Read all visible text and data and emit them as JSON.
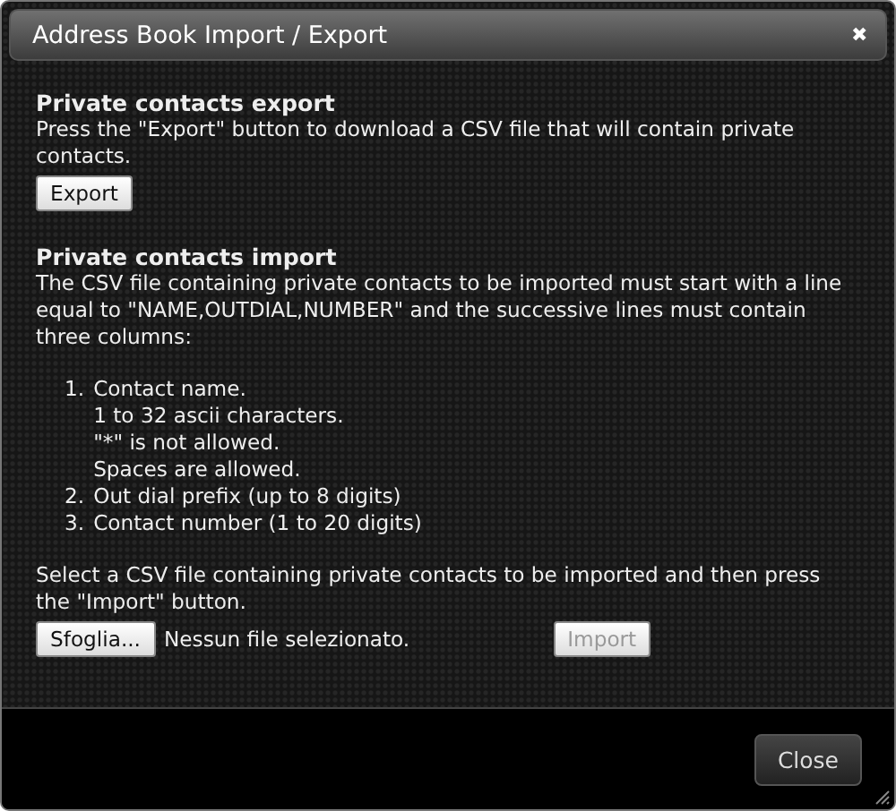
{
  "window": {
    "title": "Address Book Import / Export",
    "close_symbol": "✖"
  },
  "export_section": {
    "heading": "Private contacts export",
    "text": "Press the \"Export\" button to download a CSV file that will contain private contacts.",
    "button": "Export"
  },
  "import_section": {
    "heading": "Private contacts import",
    "text": "The CSV file containing private contacts to be imported must start with a line equal to \"NAME,OUTDIAL,NUMBER\" and the successive lines must contain three columns:",
    "columns": [
      {
        "number": "1.",
        "text": "Contact name.",
        "details": [
          "1 to 32 ascii characters.",
          "\"*\" is not allowed.",
          "Spaces are allowed."
        ]
      },
      {
        "number": "2.",
        "text": "Out dial prefix (up to 8 digits)"
      },
      {
        "number": "3.",
        "text": "Contact number (1 to 20 digits)"
      }
    ],
    "instruction": "Select a CSV file containing private contacts to be imported and then press the \"Import\" button.",
    "browse_button": "Sfoglia...",
    "file_status": "Nessun file selezionato.",
    "import_button": {
      "label": "Import",
      "disabled": true
    }
  },
  "footer": {
    "button": "Close"
  }
}
